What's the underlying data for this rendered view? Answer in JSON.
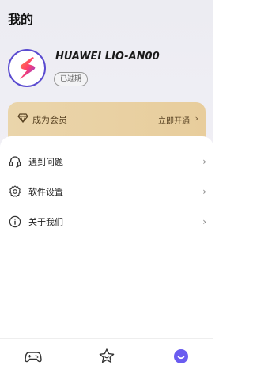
{
  "header": {
    "title": "我的"
  },
  "profile": {
    "avatar_icon": "app-logo-icon",
    "device_name": "HUAWEI LIO-AN00",
    "status": "已过期"
  },
  "membership": {
    "icon": "diamond-icon",
    "label": "成为会员",
    "action": "立即开通",
    "chevron": "›",
    "colors": {
      "gold": "#e8cf9f",
      "text": "#5a4424"
    }
  },
  "menu": {
    "items": [
      {
        "label": "遇到问题",
        "icon": "headset-icon",
        "chevron": "›"
      },
      {
        "label": "软件设置",
        "icon": "gear-icon",
        "chevron": "›"
      },
      {
        "label": "关于我们",
        "icon": "info-icon",
        "chevron": "›"
      }
    ]
  },
  "bottom_nav": {
    "items": [
      {
        "icon": "gamepad-icon",
        "active": false
      },
      {
        "icon": "star-icon",
        "active": false
      },
      {
        "icon": "profile-icon",
        "active": true
      }
    ],
    "colors": {
      "active": "#6a5cf0",
      "inactive": "#333333"
    }
  }
}
